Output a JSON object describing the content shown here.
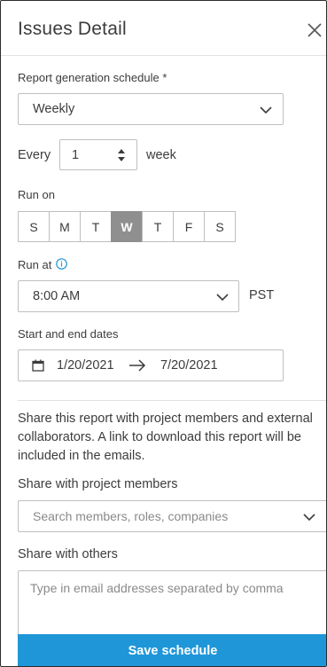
{
  "header": {
    "title": "Issues Detail",
    "close_icon": "close-icon"
  },
  "schedule": {
    "label": "Report generation schedule *",
    "value": "Weekly"
  },
  "every": {
    "prefix": "Every",
    "value": "1",
    "unit": "week"
  },
  "run_on": {
    "label": "Run on",
    "days": [
      "S",
      "M",
      "T",
      "W",
      "T",
      "F",
      "S"
    ],
    "selected": "W"
  },
  "run_at": {
    "label": "Run at",
    "info_icon": "info-icon",
    "time": "8:00 AM",
    "timezone": "PST"
  },
  "dates": {
    "label": "Start and end dates",
    "calendar_icon": "calendar-icon",
    "start": "1/20/2021",
    "end": "7/20/2021"
  },
  "share": {
    "description": "Share this report with project members and external collaborators. A link to download this report will be included in the emails.",
    "members_label": "Share with project members",
    "members_placeholder": "Search members, roles, companies",
    "others_label": "Share with others",
    "others_placeholder": "Type in email addresses separated by comma"
  },
  "footer": {
    "save_label": "Save schedule"
  },
  "colors": {
    "accent": "#1f96d8",
    "selected_day": "#8f8f8f",
    "border": "#bfbfbf",
    "text": "#3c3c3c"
  }
}
